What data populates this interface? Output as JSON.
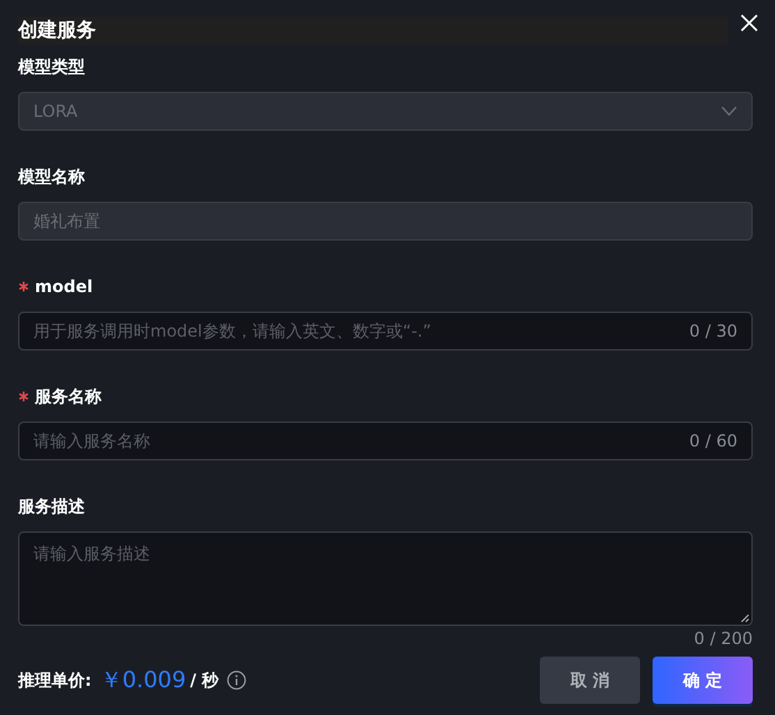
{
  "dialog": {
    "title": "创建服务"
  },
  "fields": [
    {
      "kind": "select",
      "label": "模型类型",
      "required": false,
      "disabled": true,
      "value": "LORA"
    },
    {
      "kind": "text",
      "label": "模型名称",
      "required": false,
      "disabled": true,
      "value": "婚礼布置"
    },
    {
      "kind": "text",
      "label": "model",
      "required": true,
      "disabled": false,
      "placeholder": "用于服务调用时model参数，请输入英文、数字或“-.”",
      "counter": "0 / 30"
    },
    {
      "kind": "text",
      "label": "服务名称",
      "required": true,
      "disabled": false,
      "placeholder": "请输入服务名称",
      "counter": "0 / 60"
    },
    {
      "kind": "textarea",
      "label": "服务描述",
      "required": false,
      "disabled": false,
      "placeholder": "请输入服务描述",
      "counter": "0 / 200"
    }
  ],
  "price": {
    "label": "推理单价:",
    "amount": "￥0.009",
    "unit": "/ 秒"
  },
  "buttons": [
    {
      "kind": "secondary",
      "label": "取 消"
    },
    {
      "kind": "primary",
      "label": "确 定"
    }
  ]
}
